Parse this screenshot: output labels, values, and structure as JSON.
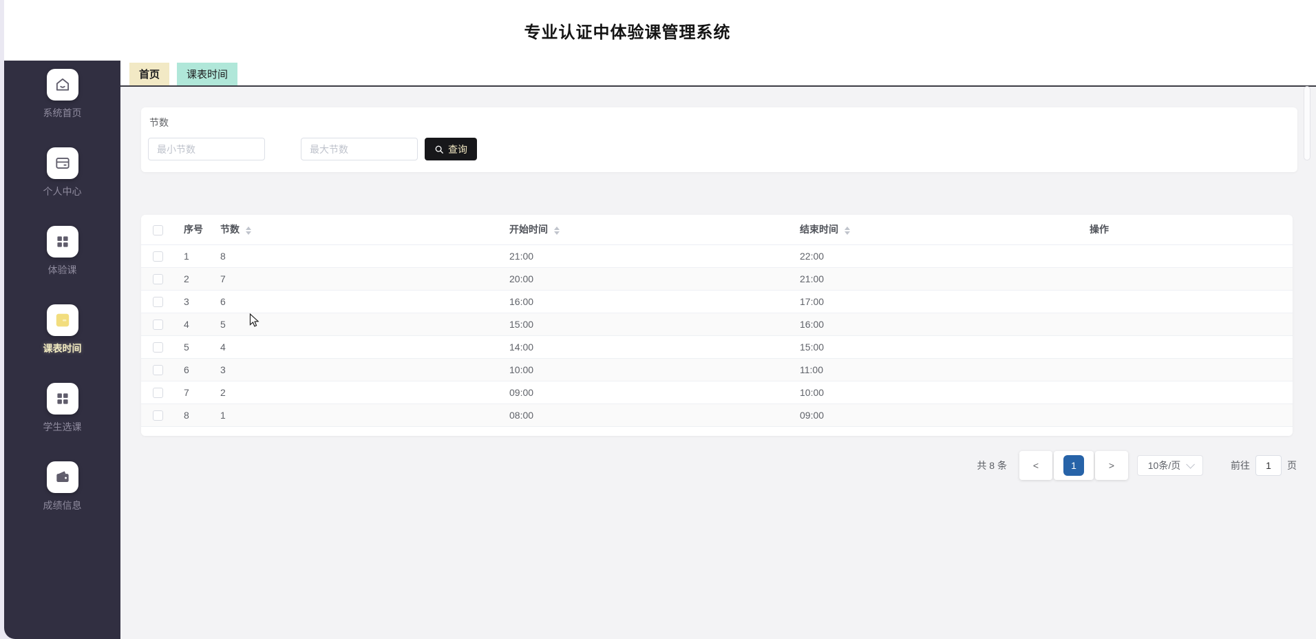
{
  "header": {
    "title": "专业认证中体验课管理系统"
  },
  "sidebar": {
    "items": [
      {
        "label": "系统首页",
        "icon": "home-icon",
        "active": false
      },
      {
        "label": "个人中心",
        "icon": "id-card-icon",
        "active": false
      },
      {
        "label": "体验课",
        "icon": "grid-icon",
        "active": false
      },
      {
        "label": "课表时间",
        "icon": "calendar-icon",
        "active": true
      },
      {
        "label": "学生选课",
        "icon": "grid-icon",
        "active": false
      },
      {
        "label": "成绩信息",
        "icon": "wallet-icon",
        "active": false
      }
    ]
  },
  "tabs": [
    {
      "label": "首页",
      "active": false
    },
    {
      "label": "课表时间",
      "active": true
    }
  ],
  "filter": {
    "group_label": "节数",
    "min_placeholder": "最小节数",
    "max_placeholder": "最大节数",
    "search_button": "查询"
  },
  "table": {
    "columns": [
      {
        "label": "序号",
        "sortable": false
      },
      {
        "label": "节数",
        "sortable": true
      },
      {
        "label": "开始时间",
        "sortable": true
      },
      {
        "label": "结束时间",
        "sortable": true
      },
      {
        "label": "操作",
        "sortable": false
      }
    ],
    "rows": [
      {
        "index": "1",
        "periods": "8",
        "start": "21:00",
        "end": "22:00"
      },
      {
        "index": "2",
        "periods": "7",
        "start": "20:00",
        "end": "21:00"
      },
      {
        "index": "3",
        "periods": "6",
        "start": "16:00",
        "end": "17:00"
      },
      {
        "index": "4",
        "periods": "5",
        "start": "15:00",
        "end": "16:00"
      },
      {
        "index": "5",
        "periods": "4",
        "start": "14:00",
        "end": "15:00"
      },
      {
        "index": "6",
        "periods": "3",
        "start": "10:00",
        "end": "11:00"
      },
      {
        "index": "7",
        "periods": "2",
        "start": "09:00",
        "end": "10:00"
      },
      {
        "index": "8",
        "periods": "1",
        "start": "08:00",
        "end": "09:00"
      }
    ]
  },
  "pagination": {
    "total": "共 8 条",
    "prev": "<",
    "current_page": "1",
    "next": ">",
    "page_size": "10条/页",
    "goto_label": "前往",
    "goto_value": "1",
    "goto_unit": "页"
  },
  "colors": {
    "sidebar_bg": "#312f41",
    "active_accent": "#f2dd7e",
    "active_label": "#f3ecc2",
    "tab_home_bg": "#f2e9c5",
    "tab_current_bg": "#b0e7d9",
    "search_button_bg": "#17171a",
    "search_button_text": "#f1e7c2",
    "page_active_bg": "#2763a8",
    "stripe_row_bg": "#fafafa"
  }
}
